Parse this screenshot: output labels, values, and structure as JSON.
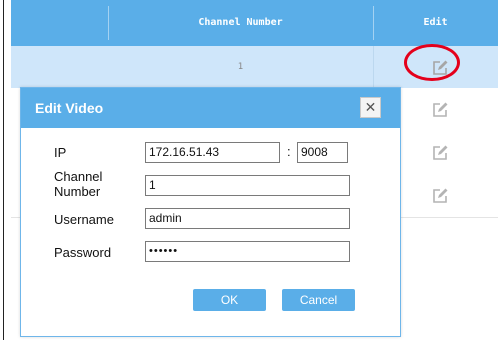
{
  "table": {
    "headers": {
      "channel_number": "Channel Number",
      "edit": "Edit"
    },
    "rows": [
      {
        "channel_number": "1"
      },
      {
        "channel_number": ""
      },
      {
        "channel_number": ""
      },
      {
        "channel_number": ""
      }
    ],
    "edit_icon": "edit-icon",
    "highlight_color": "#e4001b"
  },
  "dialog": {
    "title": "Edit Video",
    "close_label": "✕",
    "fields": {
      "ip": {
        "label": "IP",
        "value": "172.16.51.43"
      },
      "port": {
        "separator": ":",
        "value": "9008"
      },
      "channel": {
        "label_line1": "Channel",
        "label_line2": "Number",
        "value": "1"
      },
      "username": {
        "label": "Username",
        "value": "admin"
      },
      "password": {
        "label": "Password",
        "value": "••••••"
      }
    },
    "ok_label": "OK",
    "cancel_label": "Cancel"
  },
  "colors": {
    "accent": "#5aaee8",
    "selected_row": "#cfe6fa"
  }
}
